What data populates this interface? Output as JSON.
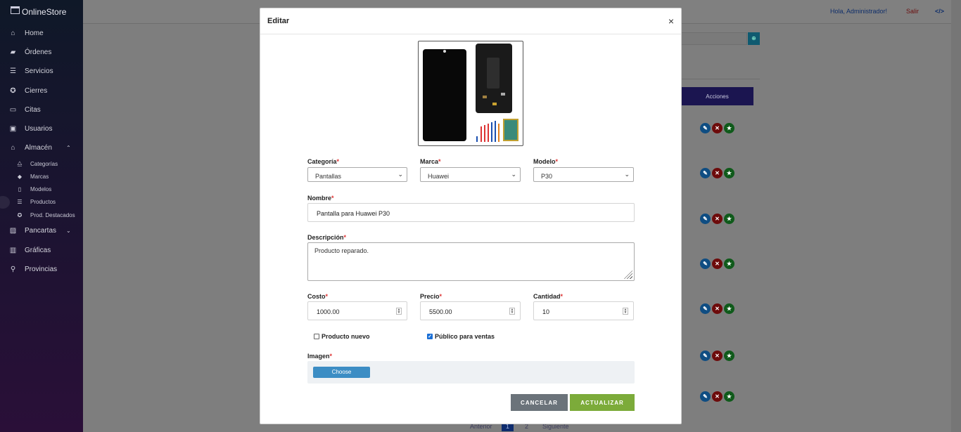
{
  "sidebar": {
    "brand": "OnlineStore",
    "items": [
      {
        "label": "Home",
        "icon": "home-icon"
      },
      {
        "label": "Órdenes",
        "icon": "truck-icon"
      },
      {
        "label": "Servicios",
        "icon": "list-icon"
      },
      {
        "label": "Cierres",
        "icon": "badge-check-icon"
      },
      {
        "label": "Citas",
        "icon": "monitor-icon"
      },
      {
        "label": "Usuarios",
        "icon": "id-card-icon"
      },
      {
        "label": "Almacén",
        "icon": "warehouse-icon"
      }
    ],
    "almacen_sub": [
      {
        "label": "Categorías",
        "icon": "sitemap-icon"
      },
      {
        "label": "Marcas",
        "icon": "tag-icon"
      },
      {
        "label": "Modelos",
        "icon": "mobile-icon"
      },
      {
        "label": "Productos",
        "icon": "list-alt-icon"
      },
      {
        "label": "Prod. Destacados",
        "icon": "star-icon"
      }
    ],
    "items_after": [
      {
        "label": "Pancartas",
        "icon": "images-icon"
      },
      {
        "label": "Gráficas",
        "icon": "chart-icon"
      },
      {
        "label": "Provincias",
        "icon": "map-marker-icon"
      }
    ]
  },
  "topbar": {
    "greeting": "Hola, Administrador!",
    "logout": "Salir",
    "code_icon": "</>"
  },
  "background": {
    "actions_header": "Acciones",
    "pagination": {
      "prev": "Anterior",
      "pages": [
        "1",
        "2"
      ],
      "next": "Siguiente"
    }
  },
  "modal": {
    "title": "Editar",
    "close": "×",
    "fields": {
      "categoria": {
        "label": "Categoría",
        "value": "Pantallas"
      },
      "marca": {
        "label": "Marca",
        "value": "Huawei"
      },
      "modelo": {
        "label": "Modelo",
        "value": "P30"
      },
      "nombre": {
        "label": "Nombre",
        "value": "Pantalla para Huawei P30"
      },
      "descripcion": {
        "label": "Descripción",
        "value": "Producto reparado."
      },
      "costo": {
        "label": "Costo",
        "value": "1000.00"
      },
      "precio": {
        "label": "Precio",
        "value": "5500.00"
      },
      "cantidad": {
        "label": "Cantidad",
        "value": "10"
      },
      "imagen": {
        "label": "Imagen",
        "button": "Choose"
      }
    },
    "required_mark": "*",
    "checkboxes": {
      "nuevo": {
        "label": "Producto nuevo",
        "checked": false
      },
      "publico": {
        "label": "Público para ventas",
        "checked": true
      }
    },
    "buttons": {
      "cancel": "CANCELAR",
      "update": "ACTUALIZAR"
    }
  }
}
